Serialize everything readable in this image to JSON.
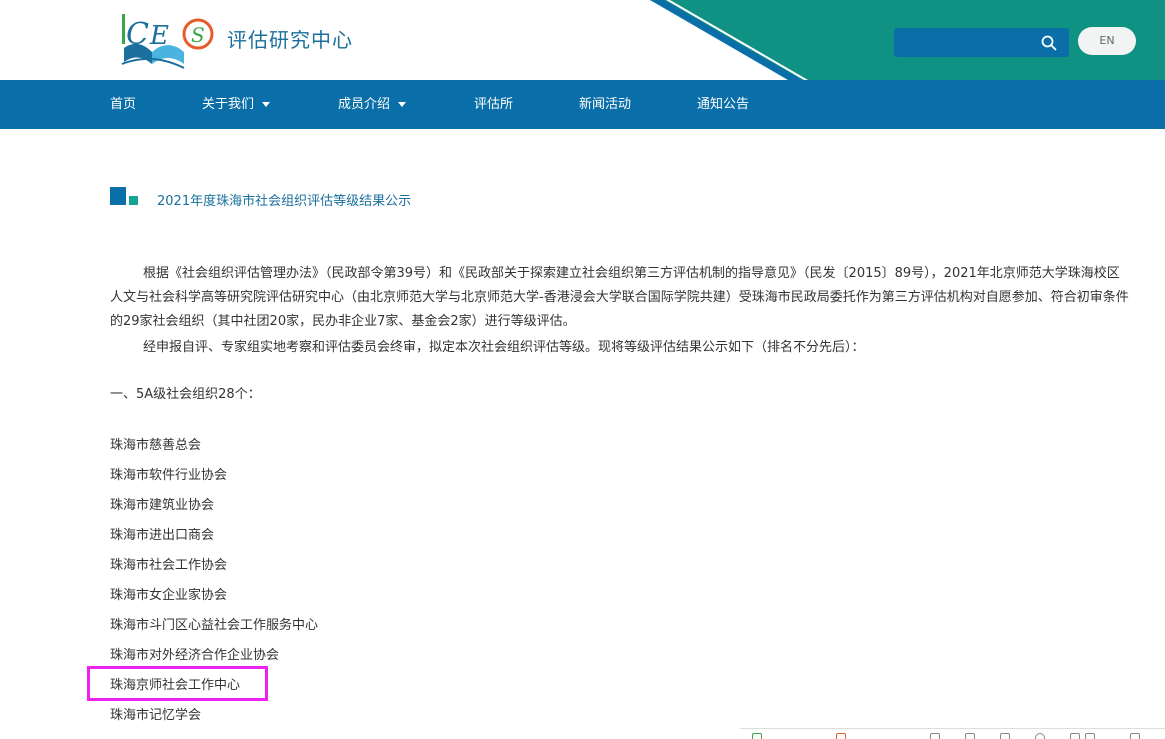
{
  "header": {
    "site_name": "评估研究中心",
    "logo_text": "CES",
    "search": {
      "placeholder": ""
    },
    "lang_label": "EN"
  },
  "nav": {
    "items": [
      {
        "label": "首页",
        "has_dropdown": false
      },
      {
        "label": "关于我们",
        "has_dropdown": true
      },
      {
        "label": "成员介绍",
        "has_dropdown": true
      },
      {
        "label": "评估所",
        "has_dropdown": false
      },
      {
        "label": "新闻活动",
        "has_dropdown": false
      },
      {
        "label": "通知公告",
        "has_dropdown": false
      }
    ]
  },
  "article": {
    "title": "2021年度珠海市社会组织评估等级结果公示",
    "paragraphs": [
      "根据《社会组织评估管理办法》（民政部令第39号）和《民政部关于探索建立社会组织第三方评估机制的指导意见》（民发〔2015〕89号），2021年北京师范大学珠海校区人文与社会科学高等研究院评估研究中心（由北京师范大学与北京师范大学-香港浸会大学联合国际学院共建）受珠海市民政局委托作为第三方评估机构对自愿参加、符合初审条件的29家社会组织（其中社团20家，民办非企业7家、基金会2家）进行等级评估。",
      "经申报自评、专家组实地考察和评估委员会终审，拟定本次社会组织评估等级。现将等级评估结果公示如下（排名不分先后）："
    ],
    "section_heading": "一、5A级社会组织28个：",
    "organizations": [
      "珠海市慈善总会",
      "珠海市软件行业协会",
      "珠海市建筑业协会",
      "珠海市进出口商会",
      "珠海市社会工作协会",
      "珠海市女企业家协会",
      "珠海市斗门区心益社会工作服务中心",
      "珠海市对外经济合作企业协会",
      "珠海京师社会工作中心",
      "珠海市记忆学会"
    ]
  },
  "colors": {
    "nav_blue": "#0a6fa8",
    "header_teal": "#0f9183",
    "title_blue": "#1a6f9c",
    "highlight": "#ee22ee"
  }
}
